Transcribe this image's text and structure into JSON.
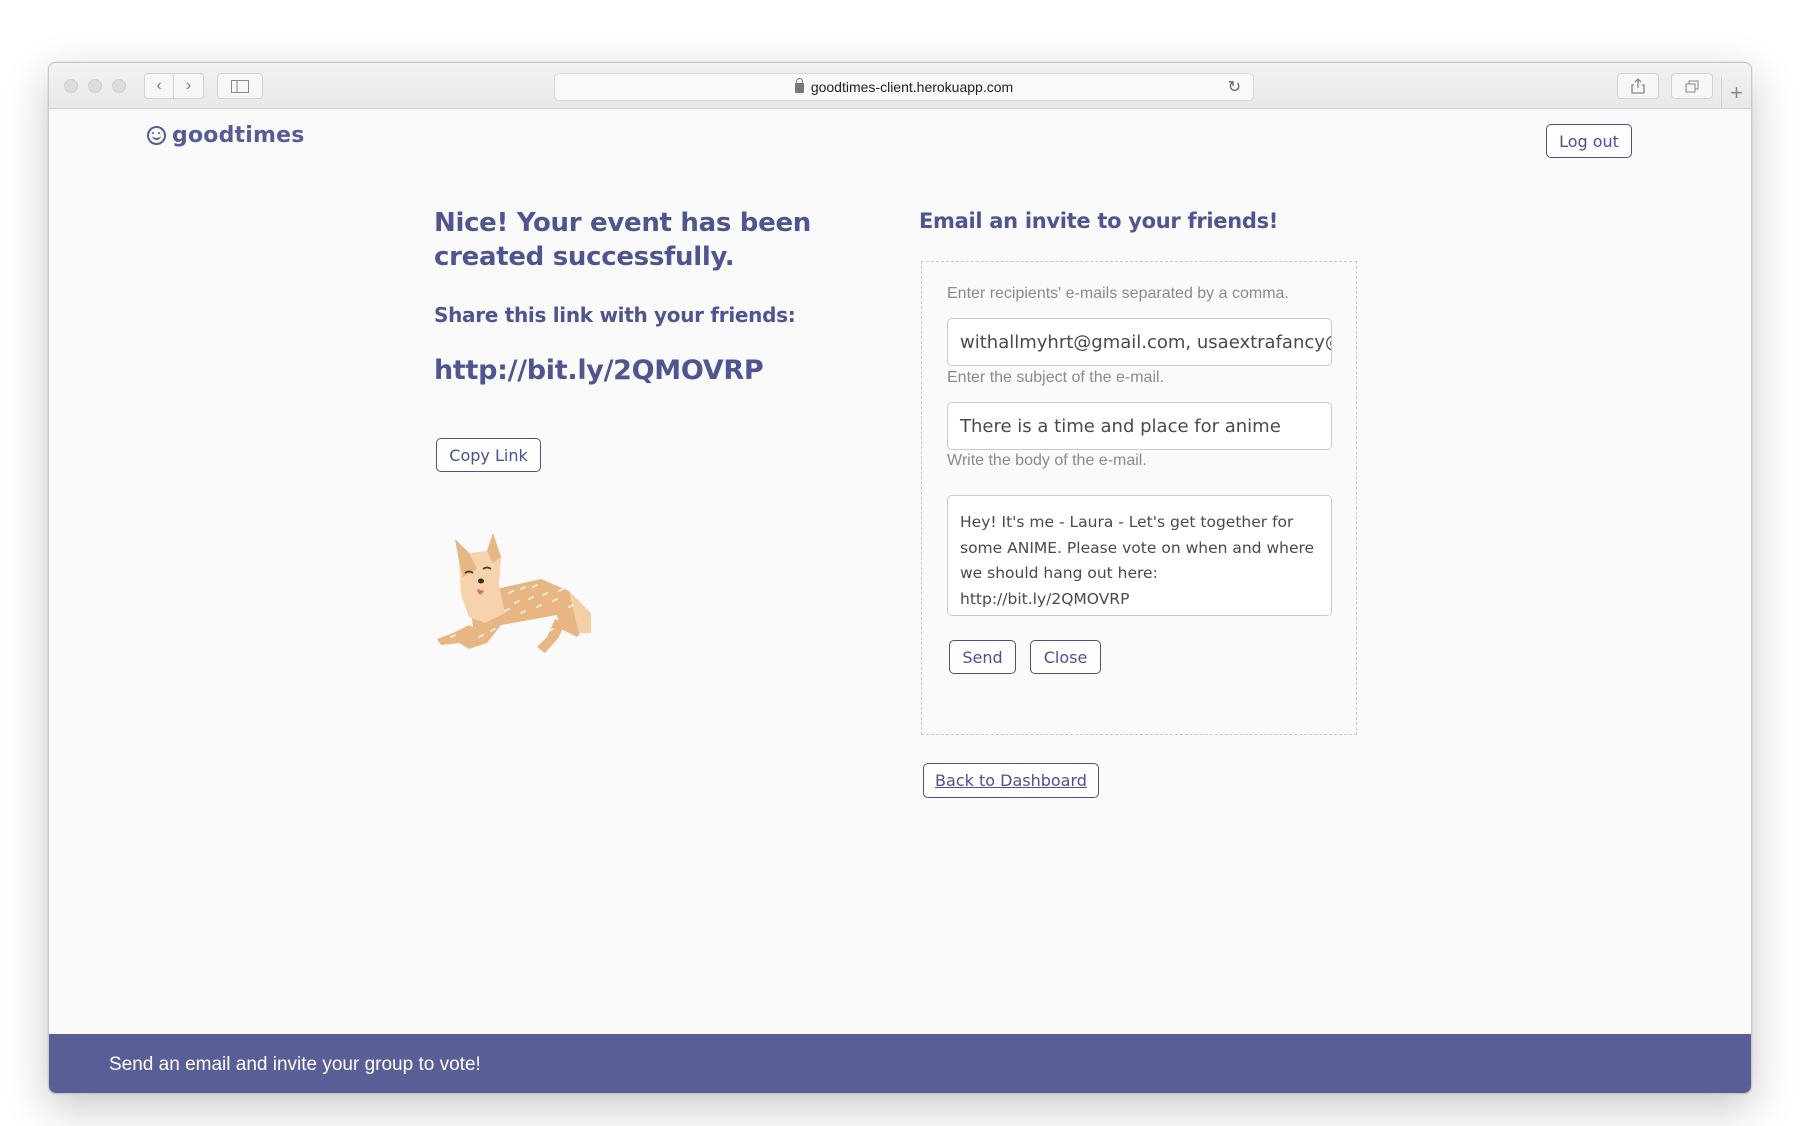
{
  "browser": {
    "url": "goodtimes-client.herokuapp.com"
  },
  "header": {
    "logo_text": "goodtimes",
    "logout_label": "Log out"
  },
  "success": {
    "heading": "Nice! Your event has been created successfully.",
    "share_heading": "Share this link with your friends:",
    "link": "http://bit.ly/2QMOVRP",
    "copy_label": "Copy Link"
  },
  "email_form": {
    "heading": "Email an invite to your friends!",
    "recipients_label": "Enter recipients' e-mails separated by a comma.",
    "recipients_value": "withallmyhrt@gmail.com, usaextrafancy@",
    "subject_label": "Enter the subject of the e-mail.",
    "subject_value": "There is a time and place for anime",
    "body_label": "Write the body of the e-mail.",
    "body_value": "Hey! It's me - Laura - Let's get together for some ANIME. Please vote on when and where we should hang out here: http://bit.ly/2QMOVRP",
    "send_label": "Send",
    "close_label": "Close"
  },
  "back_label": "Back to Dashboard",
  "footer": {
    "message": "Send an email and invite your group to vote!"
  },
  "colors": {
    "brand": "#4f5590",
    "footer_bg": "#595e96"
  }
}
